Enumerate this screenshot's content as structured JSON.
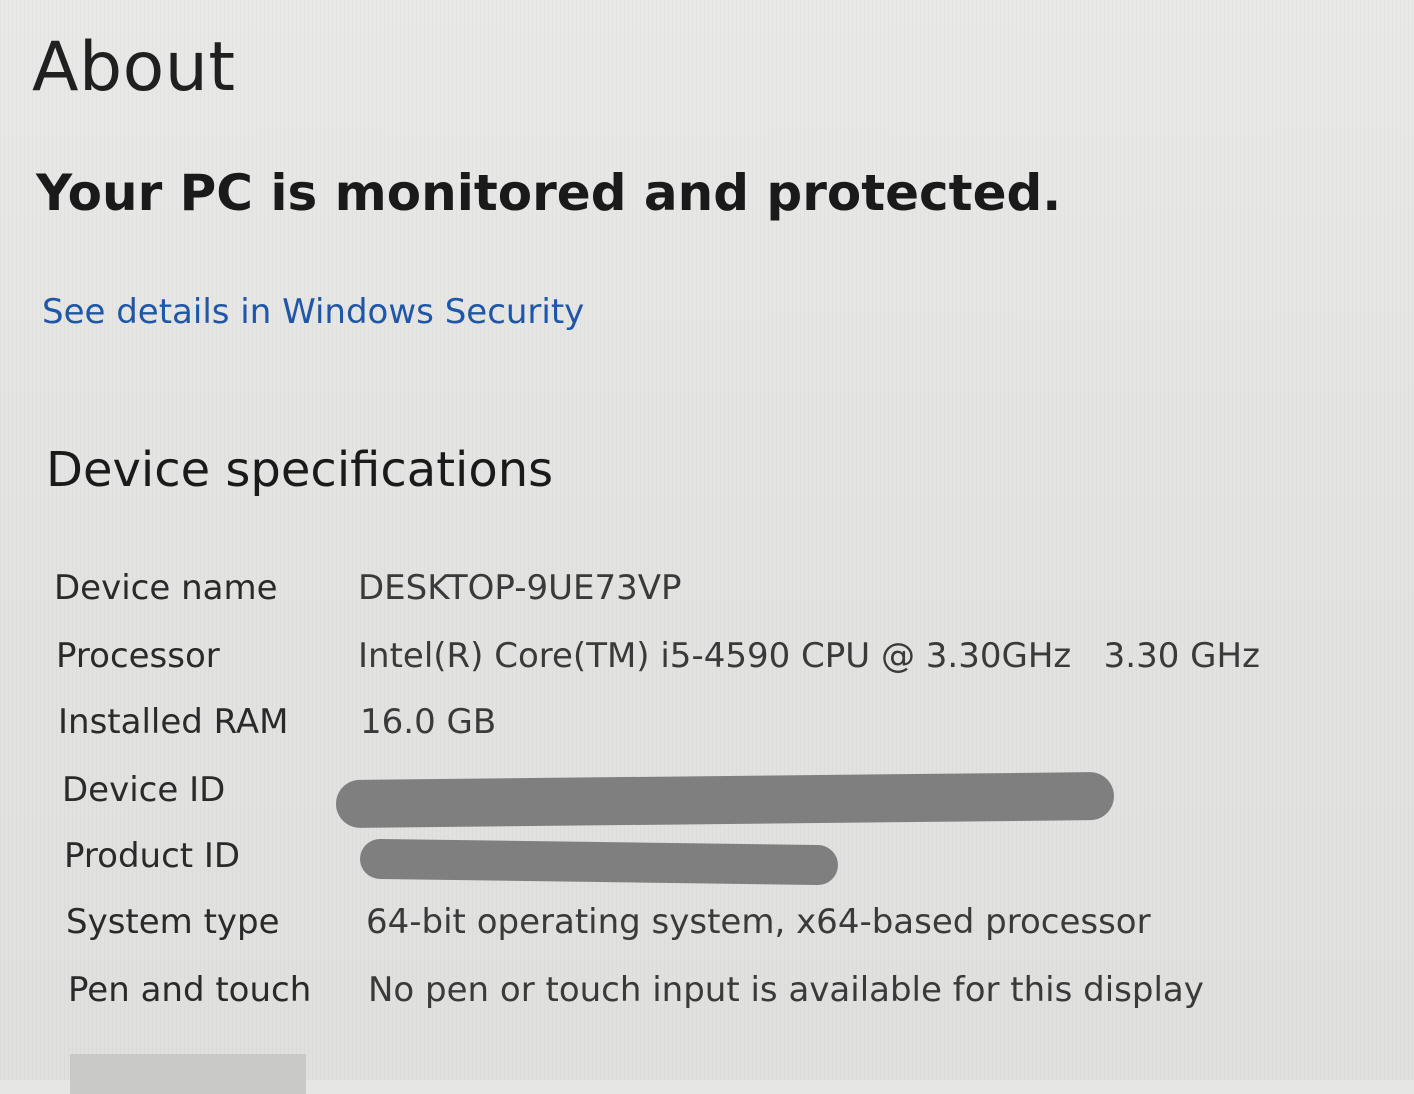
{
  "page": {
    "title": "About"
  },
  "security": {
    "status_heading": "Your PC is monitored and protected.",
    "details_link": "See details in Windows Security"
  },
  "device_specifications": {
    "heading": "Device specifications",
    "rows": [
      {
        "label": "Device name",
        "value": "DESKTOP-9UE73VP"
      },
      {
        "label": "Processor",
        "value": "Intel(R) Core(TM) i5-4590 CPU @ 3.30GHz   3.30 GHz"
      },
      {
        "label": "Installed RAM",
        "value": "16.0 GB"
      },
      {
        "label": "Device ID",
        "value": ""
      },
      {
        "label": "Product ID",
        "value": ""
      },
      {
        "label": "System type",
        "value": "64-bit operating system, x64-based processor"
      },
      {
        "label": "Pen and touch",
        "value": "No pen or touch input is available for this display"
      }
    ]
  },
  "colors": {
    "background": "#e6e6e4",
    "link": "#1f56a8",
    "redaction": "#7f7f7f"
  }
}
